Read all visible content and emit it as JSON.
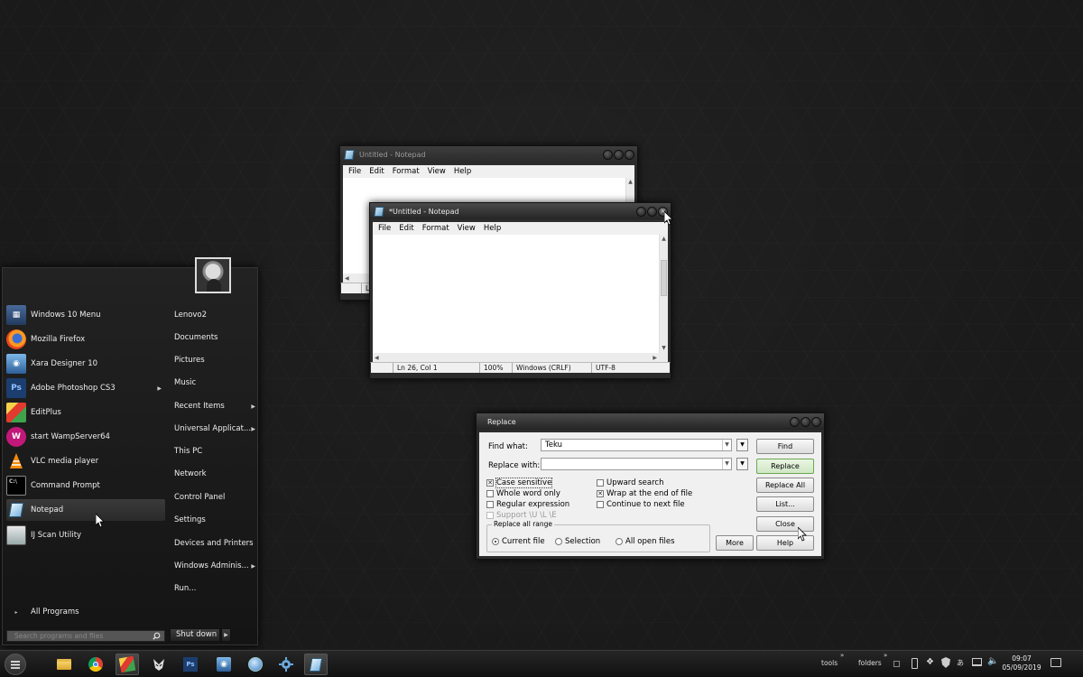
{
  "notepad_back": {
    "title": "Untitled - Notepad",
    "menu": [
      "File",
      "Edit",
      "Format",
      "View",
      "Help"
    ],
    "status_partial": "L"
  },
  "notepad_front": {
    "title": "*Untitled - Notepad",
    "menu": [
      "File",
      "Edit",
      "Format",
      "View",
      "Help"
    ],
    "status": {
      "position": "Ln 26, Col 1",
      "zoom": "100%",
      "line_ending": "Windows (CRLF)",
      "encoding": "UTF-8"
    }
  },
  "replace_dialog": {
    "title": "Replace",
    "find_label": "Find what:",
    "find_value": "Teku",
    "replace_label": "Replace with:",
    "replace_value": "",
    "options": [
      {
        "label": "Case sensitive",
        "checked": true,
        "disabled": false
      },
      {
        "label": "Whole word only",
        "checked": false,
        "disabled": false
      },
      {
        "label": "Regular expression",
        "checked": false,
        "disabled": false
      },
      {
        "label": "Support \\U \\L \\E",
        "checked": false,
        "disabled": true
      }
    ],
    "options_right": [
      {
        "label": "Upward search",
        "checked": false
      },
      {
        "label": "Wrap at the end of file",
        "checked": true
      },
      {
        "label": "Continue to next file",
        "checked": false
      }
    ],
    "range_group": "Replace all range",
    "range_options": [
      {
        "label": "Current file",
        "selected": true
      },
      {
        "label": "Selection",
        "selected": false
      },
      {
        "label": "All open files",
        "selected": false
      }
    ],
    "buttons": {
      "find": "Find",
      "replace": "Replace",
      "replace_all": "Replace All",
      "list": "List...",
      "close": "Close",
      "help": "Help",
      "more": "More"
    }
  },
  "start_menu": {
    "pinned": [
      {
        "label": "Windows 10 Menu",
        "icon": "windows-menu-icon",
        "submenu": false
      },
      {
        "label": "Mozilla Firefox",
        "icon": "firefox-icon",
        "submenu": false
      },
      {
        "label": "Xara Designer 10",
        "icon": "xara-icon",
        "submenu": false
      },
      {
        "label": "Adobe Photoshop CS3",
        "icon": "photoshop-icon",
        "submenu": true
      },
      {
        "label": "EditPlus",
        "icon": "editplus-icon",
        "submenu": false
      },
      {
        "label": "start WampServer64",
        "icon": "wampserver-icon",
        "submenu": false
      },
      {
        "label": "VLC media player",
        "icon": "vlc-icon",
        "submenu": false
      },
      {
        "label": "Command Prompt",
        "icon": "cmd-icon",
        "submenu": false
      },
      {
        "label": "Notepad",
        "icon": "notepad-icon",
        "submenu": false
      },
      {
        "label": "IJ Scan Utility",
        "icon": "scan-icon",
        "submenu": false
      }
    ],
    "all_programs": "All Programs",
    "search_placeholder": "Search programs and files",
    "right_items": [
      {
        "label": "Lenovo2",
        "submenu": false
      },
      {
        "label": "Documents",
        "submenu": false
      },
      {
        "label": "Pictures",
        "submenu": false
      },
      {
        "label": "Music",
        "submenu": false
      },
      {
        "label": "Recent Items",
        "submenu": true
      },
      {
        "label": "Universal Applicat...",
        "submenu": true
      },
      {
        "label": "This PC",
        "submenu": false
      },
      {
        "label": "Network",
        "submenu": false
      },
      {
        "label": "Control Panel",
        "submenu": false
      },
      {
        "label": "Settings",
        "submenu": false
      },
      {
        "label": "Devices and Printers",
        "submenu": false
      },
      {
        "label": "Windows Adminis...",
        "submenu": true
      },
      {
        "label": "Run...",
        "submenu": false
      }
    ],
    "shutdown": "Shut down"
  },
  "taskbar": {
    "toolbars": [
      "tools",
      "folders"
    ],
    "time": "09:07",
    "date": "05/09/2019"
  }
}
